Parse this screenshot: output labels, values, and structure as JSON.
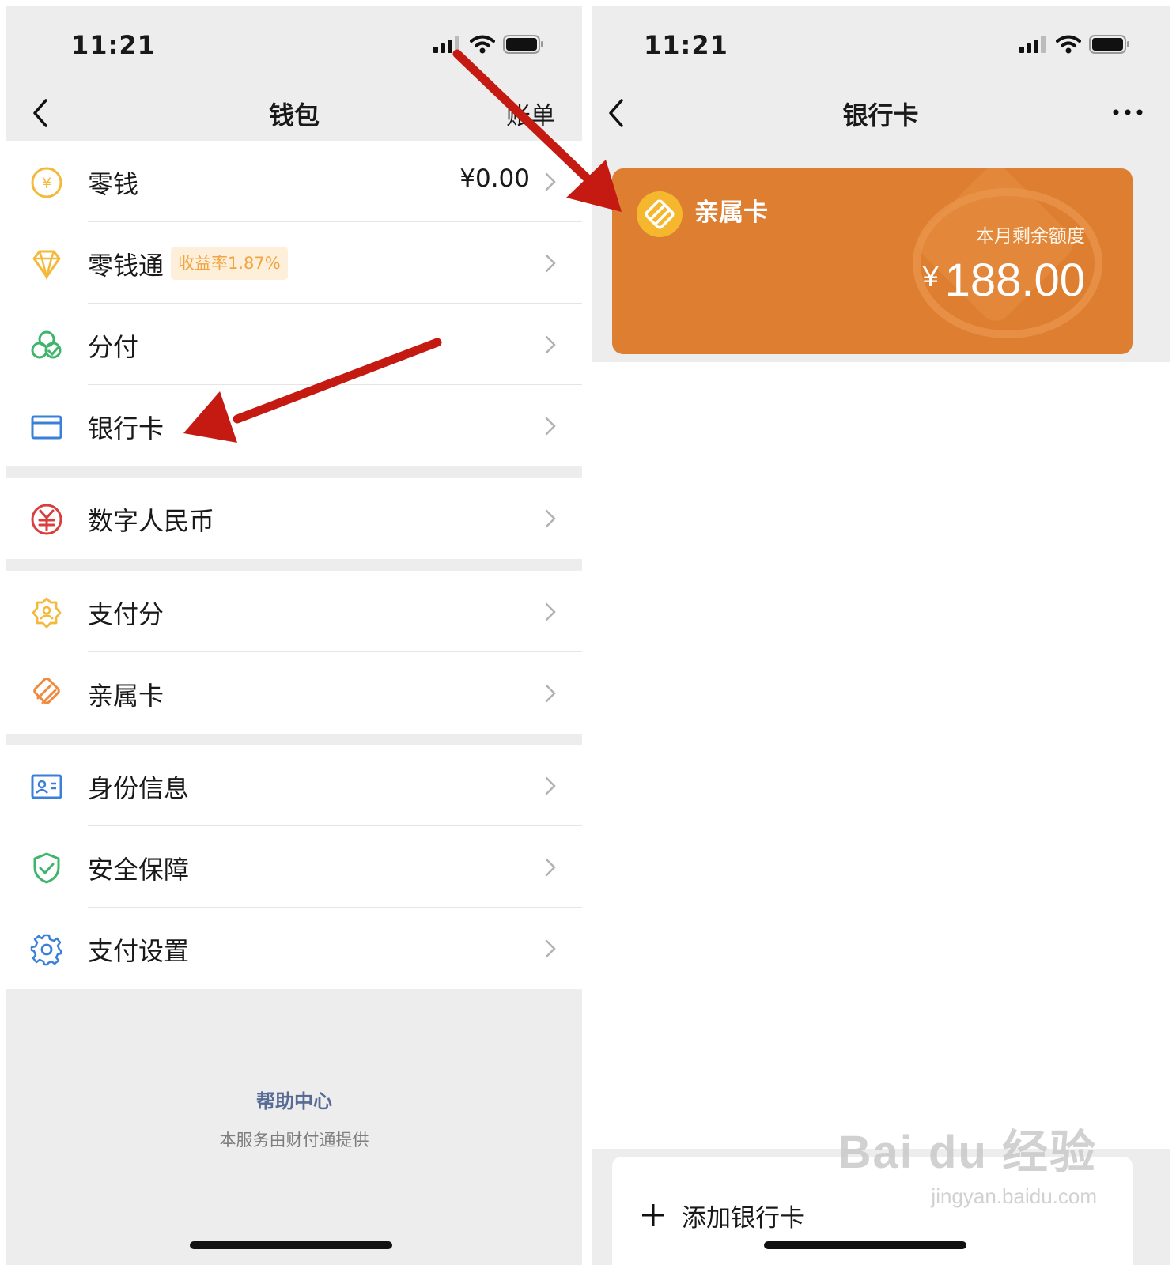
{
  "status": {
    "time": "11:21"
  },
  "wallet": {
    "title": "钱包",
    "bill_label": "账单",
    "rows": [
      {
        "label": "零钱",
        "value": "¥0.00"
      },
      {
        "label": "零钱通",
        "badge": "收益率1.87%"
      },
      {
        "label": "分付"
      },
      {
        "label": "银行卡"
      },
      {
        "label": "数字人民币"
      },
      {
        "label": "支付分"
      },
      {
        "label": "亲属卡"
      },
      {
        "label": "身份信息"
      },
      {
        "label": "安全保障"
      },
      {
        "label": "支付设置"
      }
    ],
    "footer": {
      "help": "帮助中心",
      "note": "本服务由财付通提供"
    }
  },
  "bankcards": {
    "title": "银行卡",
    "card": {
      "name": "亲属卡",
      "subtitle": "本月剩余额度",
      "currency": "¥",
      "amount": "188.00",
      "color": "#de7e31"
    },
    "add_label": "添加银行卡"
  },
  "watermark": {
    "brand": "Bai du 经验",
    "url": "jingyan.baidu.com"
  },
  "colors": {
    "annotation_arrow": "#c41a12",
    "link": "#576b95",
    "badge_text": "#f1a541"
  }
}
